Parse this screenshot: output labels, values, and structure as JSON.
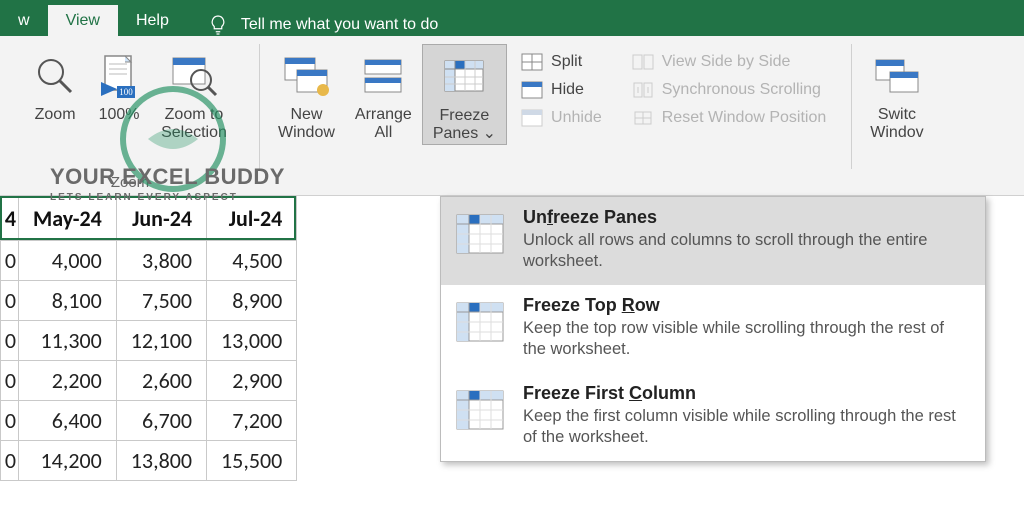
{
  "tabs": {
    "prev": "w",
    "active": "View",
    "next": "Help"
  },
  "tell_me": "Tell me what you want to do",
  "ribbon": {
    "zoom": {
      "zoom": "Zoom",
      "hundred": "100%",
      "to_sel": "Zoom to\nSelection",
      "group": "Zoom"
    },
    "window": {
      "new_window": "New\nWindow",
      "arrange_all": "Arrange\nAll",
      "freeze": "Freeze\nPanes ⌄",
      "split": "Split",
      "hide": "Hide",
      "unhide": "Unhide",
      "side_by_side": "View Side by Side",
      "sync_scroll": "Synchronous Scrolling",
      "reset_pos": "Reset Window Position",
      "switch": "Switc\nWindov"
    }
  },
  "dropdown": {
    "items": [
      {
        "title_pre": "Un",
        "title_u": "f",
        "title_post": "reeze Panes",
        "desc": "Unlock all rows and columns to scroll through the entire worksheet."
      },
      {
        "title_pre": "Freeze Top ",
        "title_u": "R",
        "title_post": "ow",
        "desc": "Keep the top row visible while scrolling through the rest of the worksheet."
      },
      {
        "title_pre": "Freeze First ",
        "title_u": "C",
        "title_post": "olumn",
        "desc": "Keep the first column visible while scrolling through the rest of the worksheet."
      }
    ]
  },
  "sheet": {
    "partial_header": "4",
    "headers": [
      "May-24",
      "Jun-24",
      "Jul-24"
    ],
    "partial_col": [
      "0",
      "0",
      "0",
      "0",
      "0",
      "0"
    ],
    "rows": [
      [
        "4,000",
        "3,800",
        "4,500"
      ],
      [
        "8,100",
        "7,500",
        "8,900"
      ],
      [
        "11,300",
        "12,100",
        "13,000"
      ],
      [
        "2,200",
        "2,600",
        "2,900"
      ],
      [
        "6,400",
        "6,700",
        "7,200"
      ],
      [
        "14,200",
        "13,800",
        "15,500"
      ]
    ]
  },
  "watermark": {
    "title": "YOUR EXCEL BUDDY",
    "sub": "LETS LEARN EVERY ASPECT"
  }
}
